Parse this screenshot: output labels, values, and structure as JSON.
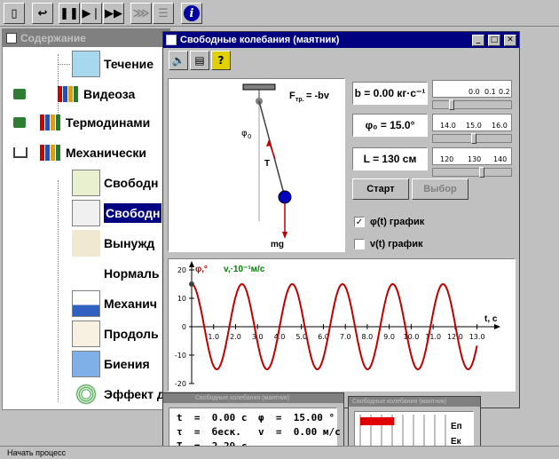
{
  "toolbar": {
    "buttons": [
      "exit-icon",
      "back-icon",
      "pause-icon",
      "step-icon",
      "fast-forward-icon",
      "disabled-skip-icon",
      "disabled-list-icon",
      "info-icon"
    ]
  },
  "toc": {
    "title": "Содержание",
    "items": [
      {
        "label": "Течение"
      },
      {
        "label": "Видеоза"
      },
      {
        "label": "Термодинами"
      },
      {
        "label": "Механически"
      },
      {
        "label": "Свободн"
      },
      {
        "label": "Свободн"
      },
      {
        "label": "Вынужд"
      },
      {
        "label": "Нормаль"
      },
      {
        "label": "Механич"
      },
      {
        "label": "Продоль"
      },
      {
        "label": "Биения"
      },
      {
        "label": "Эффект д"
      }
    ]
  },
  "sim": {
    "title": "Свободные колебания (маятник)",
    "params": {
      "b": "b = 0.00 кг·c⁻¹",
      "phi0": "φ₀ = 15.0°",
      "L": "L = 130 см"
    },
    "sliders": [
      {
        "ticks": [
          "0.0",
          "0.1",
          "0.2"
        ],
        "value_fraction": 0.18
      },
      {
        "ticks": [
          "14.0",
          "15.0",
          "16.0"
        ],
        "value_fraction": 0.5
      },
      {
        "ticks": [
          "120",
          "130",
          "140"
        ],
        "value_fraction": 0.62
      }
    ],
    "start_label": "Старт",
    "select_label": "Выбор",
    "check_phi": {
      "label": "φ(t) график",
      "checked": true
    },
    "check_v": {
      "label": "v(t) график",
      "checked": false
    },
    "pendulum": {
      "friction_label": "F",
      "friction_sub": "тр.",
      "friction_rhs": "= -bv",
      "phi0_label": "φ",
      "phi0_sub": "0",
      "T_label": "T",
      "mg_label": "mg"
    }
  },
  "chart_data": {
    "type": "line",
    "ylabel": "φ,° v,·10⁻¹м/c",
    "ylabel_phi": "φ,°",
    "ylabel_v": "v,·10⁻¹м/c",
    "xlabel": "t, c",
    "xlim": [
      0,
      13.5
    ],
    "ylim": [
      -20,
      20
    ],
    "x_ticks": [
      "1.0",
      "2.0",
      "3.0",
      "4.0",
      "5.0",
      "6.0",
      "7.0",
      "8.0",
      "9.0",
      "10.0",
      "11.0",
      "12.0",
      "13.0"
    ],
    "y_ticks": [
      "20",
      "10",
      "0",
      "-10",
      "-20"
    ],
    "series": [
      {
        "amplitude": 15.0,
        "period": 2.29,
        "phase_at_t0": "max",
        "color": "#c00000"
      }
    ]
  },
  "info": {
    "title": "Свободные колебания (маятник)",
    "t": "t  =  0.00 c",
    "phi": "φ  =  15.00 °",
    "tau": "τ  =  беск.",
    "v": "v  =  0.00 м/с",
    "T": "T  =  2.29 с"
  },
  "energy": {
    "title": "Свободные колебания (маятник)",
    "Ep": "Eп",
    "Ek": "Eк",
    "Ep_fraction": 0.4,
    "Ek_fraction": 0.0
  },
  "status": "Начать процесс",
  "colors": {
    "title_active": "#000080",
    "curve": "#c00000",
    "ball": "#0000c0"
  }
}
